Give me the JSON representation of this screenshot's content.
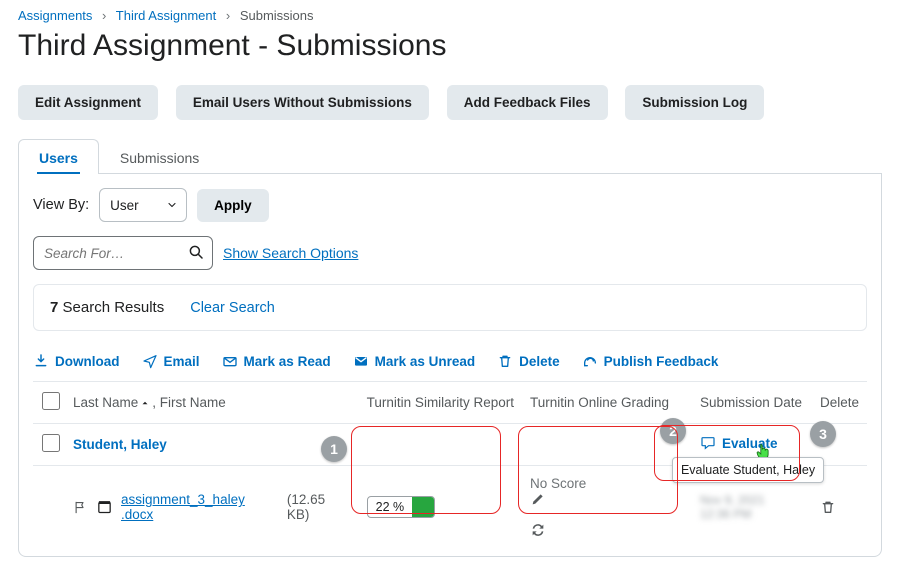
{
  "breadcrumb": {
    "assignments": "Assignments",
    "third": "Third Assignment",
    "current": "Submissions"
  },
  "page_title": "Third Assignment - Submissions",
  "buttons": {
    "edit": "Edit Assignment",
    "email_without": "Email Users Without Submissions",
    "add_feedback": "Add Feedback Files",
    "submission_log": "Submission Log"
  },
  "tabs": {
    "users": "Users",
    "submissions": "Submissions"
  },
  "viewby": {
    "label": "View By:",
    "value": "User",
    "apply": "Apply"
  },
  "search": {
    "placeholder": "Search For…",
    "show_options": "Show Search Options"
  },
  "results": {
    "count": "7",
    "label": "Search Results",
    "clear": "Clear Search"
  },
  "actions": {
    "download": "Download",
    "email": "Email",
    "mark_read": "Mark as Read",
    "mark_unread": "Mark as Unread",
    "delete": "Delete",
    "publish": "Publish Feedback"
  },
  "table": {
    "headers": {
      "name": "Last Name",
      "name_suffix": ", First Name",
      "similarity": "Turnitin Similarity Report",
      "online_grading": "Turnitin Online Grading",
      "submission_date": "Submission Date",
      "delete": "Delete"
    },
    "student": {
      "display": "Student, Haley",
      "tooltip": "Evaluate Student, Haley"
    },
    "file": {
      "name": "assignment_3_haley .docx",
      "size": "(12.65 KB)"
    },
    "similarity": {
      "value": "22 %"
    },
    "online_grading": {
      "no_score": "No Score"
    },
    "evaluate": "Evaluate"
  },
  "annotations": {
    "a1": "1",
    "a2": "2",
    "a3": "3"
  }
}
